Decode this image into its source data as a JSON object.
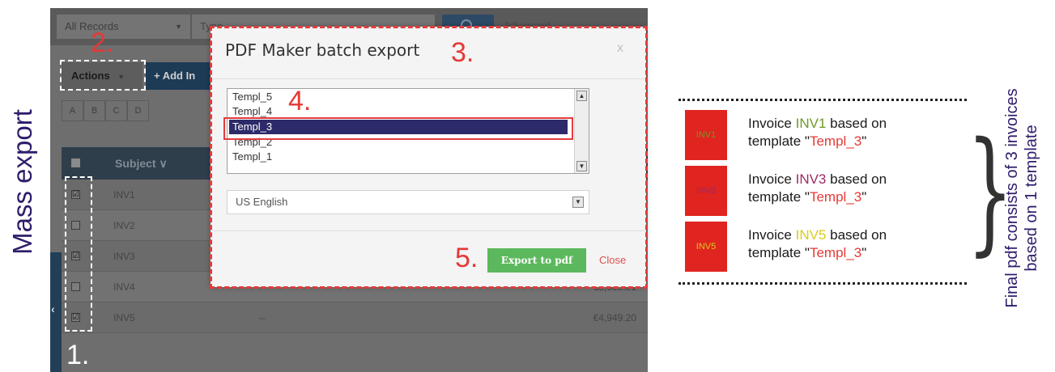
{
  "title": "Mass export",
  "crm": {
    "search_scope": "All Records",
    "search_placeholder": "Type",
    "search_icon": "search-icon",
    "advanced": "Advanced",
    "actions": "Actions",
    "add": "+ Add In",
    "alphabet": [
      "A",
      "B",
      "C",
      "D"
    ],
    "subject_header": "Subject ∨",
    "rows": [
      {
        "checked": "☑",
        "subject": "INV1",
        "dash": "",
        "amount": ""
      },
      {
        "checked": "",
        "subject": "INV2",
        "dash": "",
        "amount": ""
      },
      {
        "checked": "☑",
        "subject": "INV3",
        "dash": "",
        "amount": ""
      },
      {
        "checked": "",
        "subject": "INV4",
        "dash": "",
        "amount": "€5,005.01"
      },
      {
        "checked": "☑",
        "subject": "INV5",
        "dash": "--",
        "amount": "€4,949.20"
      }
    ],
    "sidebar_toggle": "‹"
  },
  "modal": {
    "title": "PDF Maker batch export",
    "close": "x",
    "templates": [
      "Templ_5",
      "Templ_4",
      "Templ_3",
      "Templ_2",
      "Templ_1"
    ],
    "selected_template": "Templ_3",
    "language": "US English",
    "export_button": "Export to pdf",
    "close_link": "Close"
  },
  "steps": [
    "1.",
    "2.",
    "3.",
    "4.",
    "5."
  ],
  "invoices": [
    {
      "box": "INV1",
      "prefix": "Invoice ",
      "name": "INV1",
      "suffix": " based on",
      "line2a": "template \"",
      "template": "Templ_3",
      "line2b": "\"",
      "color": "#6e9a28"
    },
    {
      "box": "INV3",
      "prefix": "Invoice ",
      "name": "INV3",
      "suffix": " based on",
      "line2a": "template \"",
      "template": "Templ_3",
      "line2b": "\"",
      "color": "#9e2a66"
    },
    {
      "box": "INV5",
      "prefix": "Invoice ",
      "name": "INV5",
      "suffix": " based on",
      "line2a": "template \"",
      "template": "Templ_3",
      "line2b": "\"",
      "color": "#d8cc1a"
    }
  ],
  "caption": {
    "line1": "Final pdf consists of 3 invoices",
    "line2": "based on 1 template"
  },
  "colors": {
    "step_red": "#e53935",
    "title_purple": "#2f1c6b",
    "export_green": "#5cb85c",
    "invoice_box": "#e0241f"
  }
}
